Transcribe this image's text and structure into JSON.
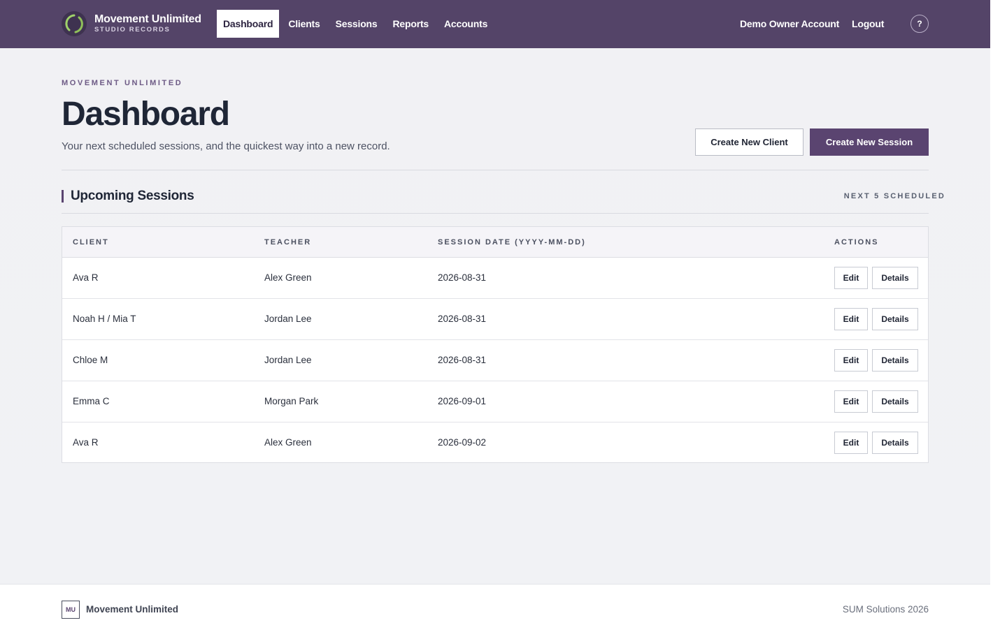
{
  "app": {
    "brand_name": "Movement Unlimited",
    "brand_sub": "STUDIO RECORDS",
    "accent_color": "#544468",
    "primary_button_color": "#5a4470"
  },
  "nav": {
    "items": [
      {
        "label": "Dashboard",
        "active": true
      },
      {
        "label": "Clients",
        "active": false
      },
      {
        "label": "Sessions",
        "active": false
      },
      {
        "label": "Reports",
        "active": false
      },
      {
        "label": "Accounts",
        "active": false
      }
    ],
    "account_label": "Demo Owner Account",
    "logout_label": "Logout",
    "help_label": "?"
  },
  "header": {
    "eyebrow": "MOVEMENT UNLIMITED",
    "title": "Dashboard",
    "subtitle": "Your next scheduled sessions, and the quickest way into a new record.",
    "create_client_label": "Create New Client",
    "create_session_label": "Create New Session"
  },
  "section": {
    "title": "Upcoming Sessions",
    "meta": "NEXT 5 SCHEDULED"
  },
  "table": {
    "columns": [
      "CLIENT",
      "TEACHER",
      "SESSION DATE (YYYY-MM-DD)",
      "ACTIONS"
    ],
    "rows": [
      {
        "client": "Ava R",
        "teacher": "Alex Green",
        "date": "2026-08-31",
        "edit": "Edit",
        "details": "Details"
      },
      {
        "client": "Noah H / Mia T",
        "teacher": "Jordan Lee",
        "date": "2026-08-31",
        "edit": "Edit",
        "details": "Details"
      },
      {
        "client": "Chloe M",
        "teacher": "Jordan Lee",
        "date": "2026-08-31",
        "edit": "Edit",
        "details": "Details"
      },
      {
        "client": "Emma C",
        "teacher": "Morgan Park",
        "date": "2026-09-01",
        "edit": "Edit",
        "details": "Details"
      },
      {
        "client": "Ava R",
        "teacher": "Alex Green",
        "date": "2026-09-02",
        "edit": "Edit",
        "details": "Details"
      }
    ]
  },
  "footer": {
    "logo_text": "MU",
    "name": "Movement Unlimited",
    "copyright": "SUM Solutions 2026"
  }
}
